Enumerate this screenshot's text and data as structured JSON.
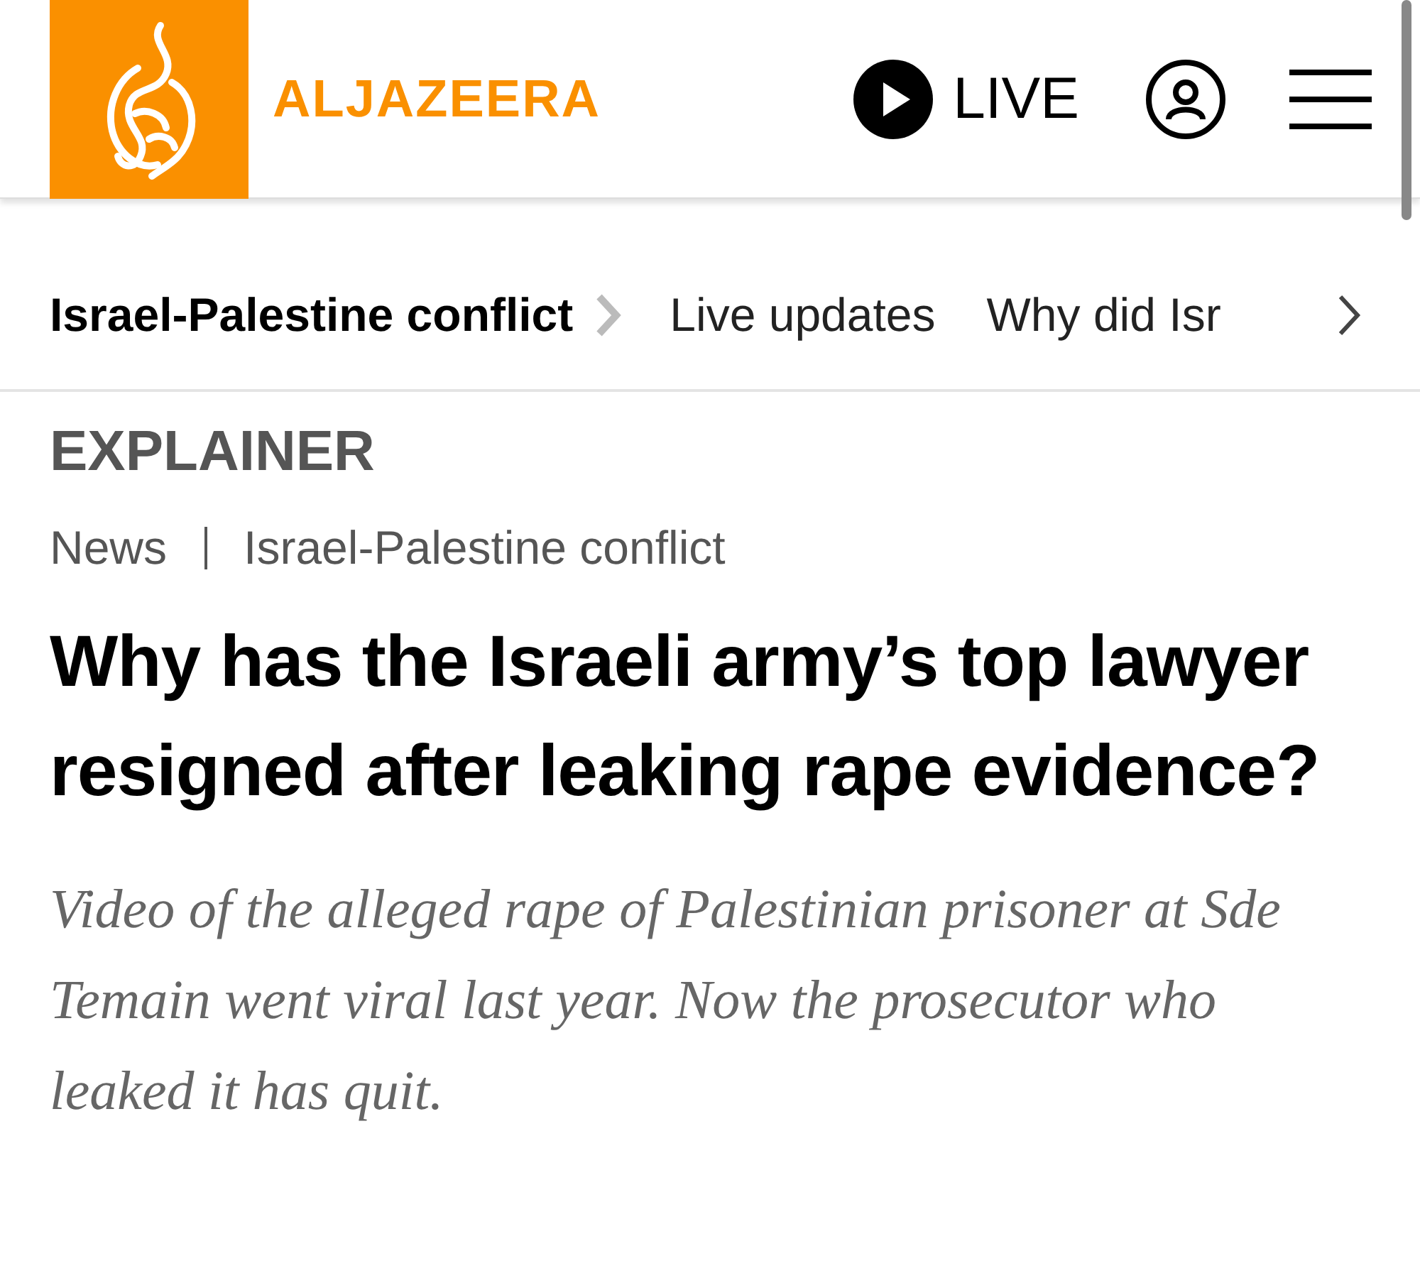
{
  "header": {
    "brand": "ALJAZEERA",
    "live_label": "LIVE"
  },
  "topic_nav": [
    {
      "label": "Israel-Palestine conflict",
      "selected": true
    },
    {
      "label": "Live updates",
      "selected": false
    },
    {
      "label": "Why did Isr",
      "selected": false
    }
  ],
  "article": {
    "label": "EXPLAINER",
    "categories": [
      "News",
      "Israel-Palestine conflict"
    ],
    "headline": "Why has the Israeli army’s top lawyer resigned after leaking rape evidence?",
    "summary": "Video of the alleged rape of Palestinian prisoner at Sde Temain went viral last year. Now the prosecutor who leaked it has quit."
  }
}
